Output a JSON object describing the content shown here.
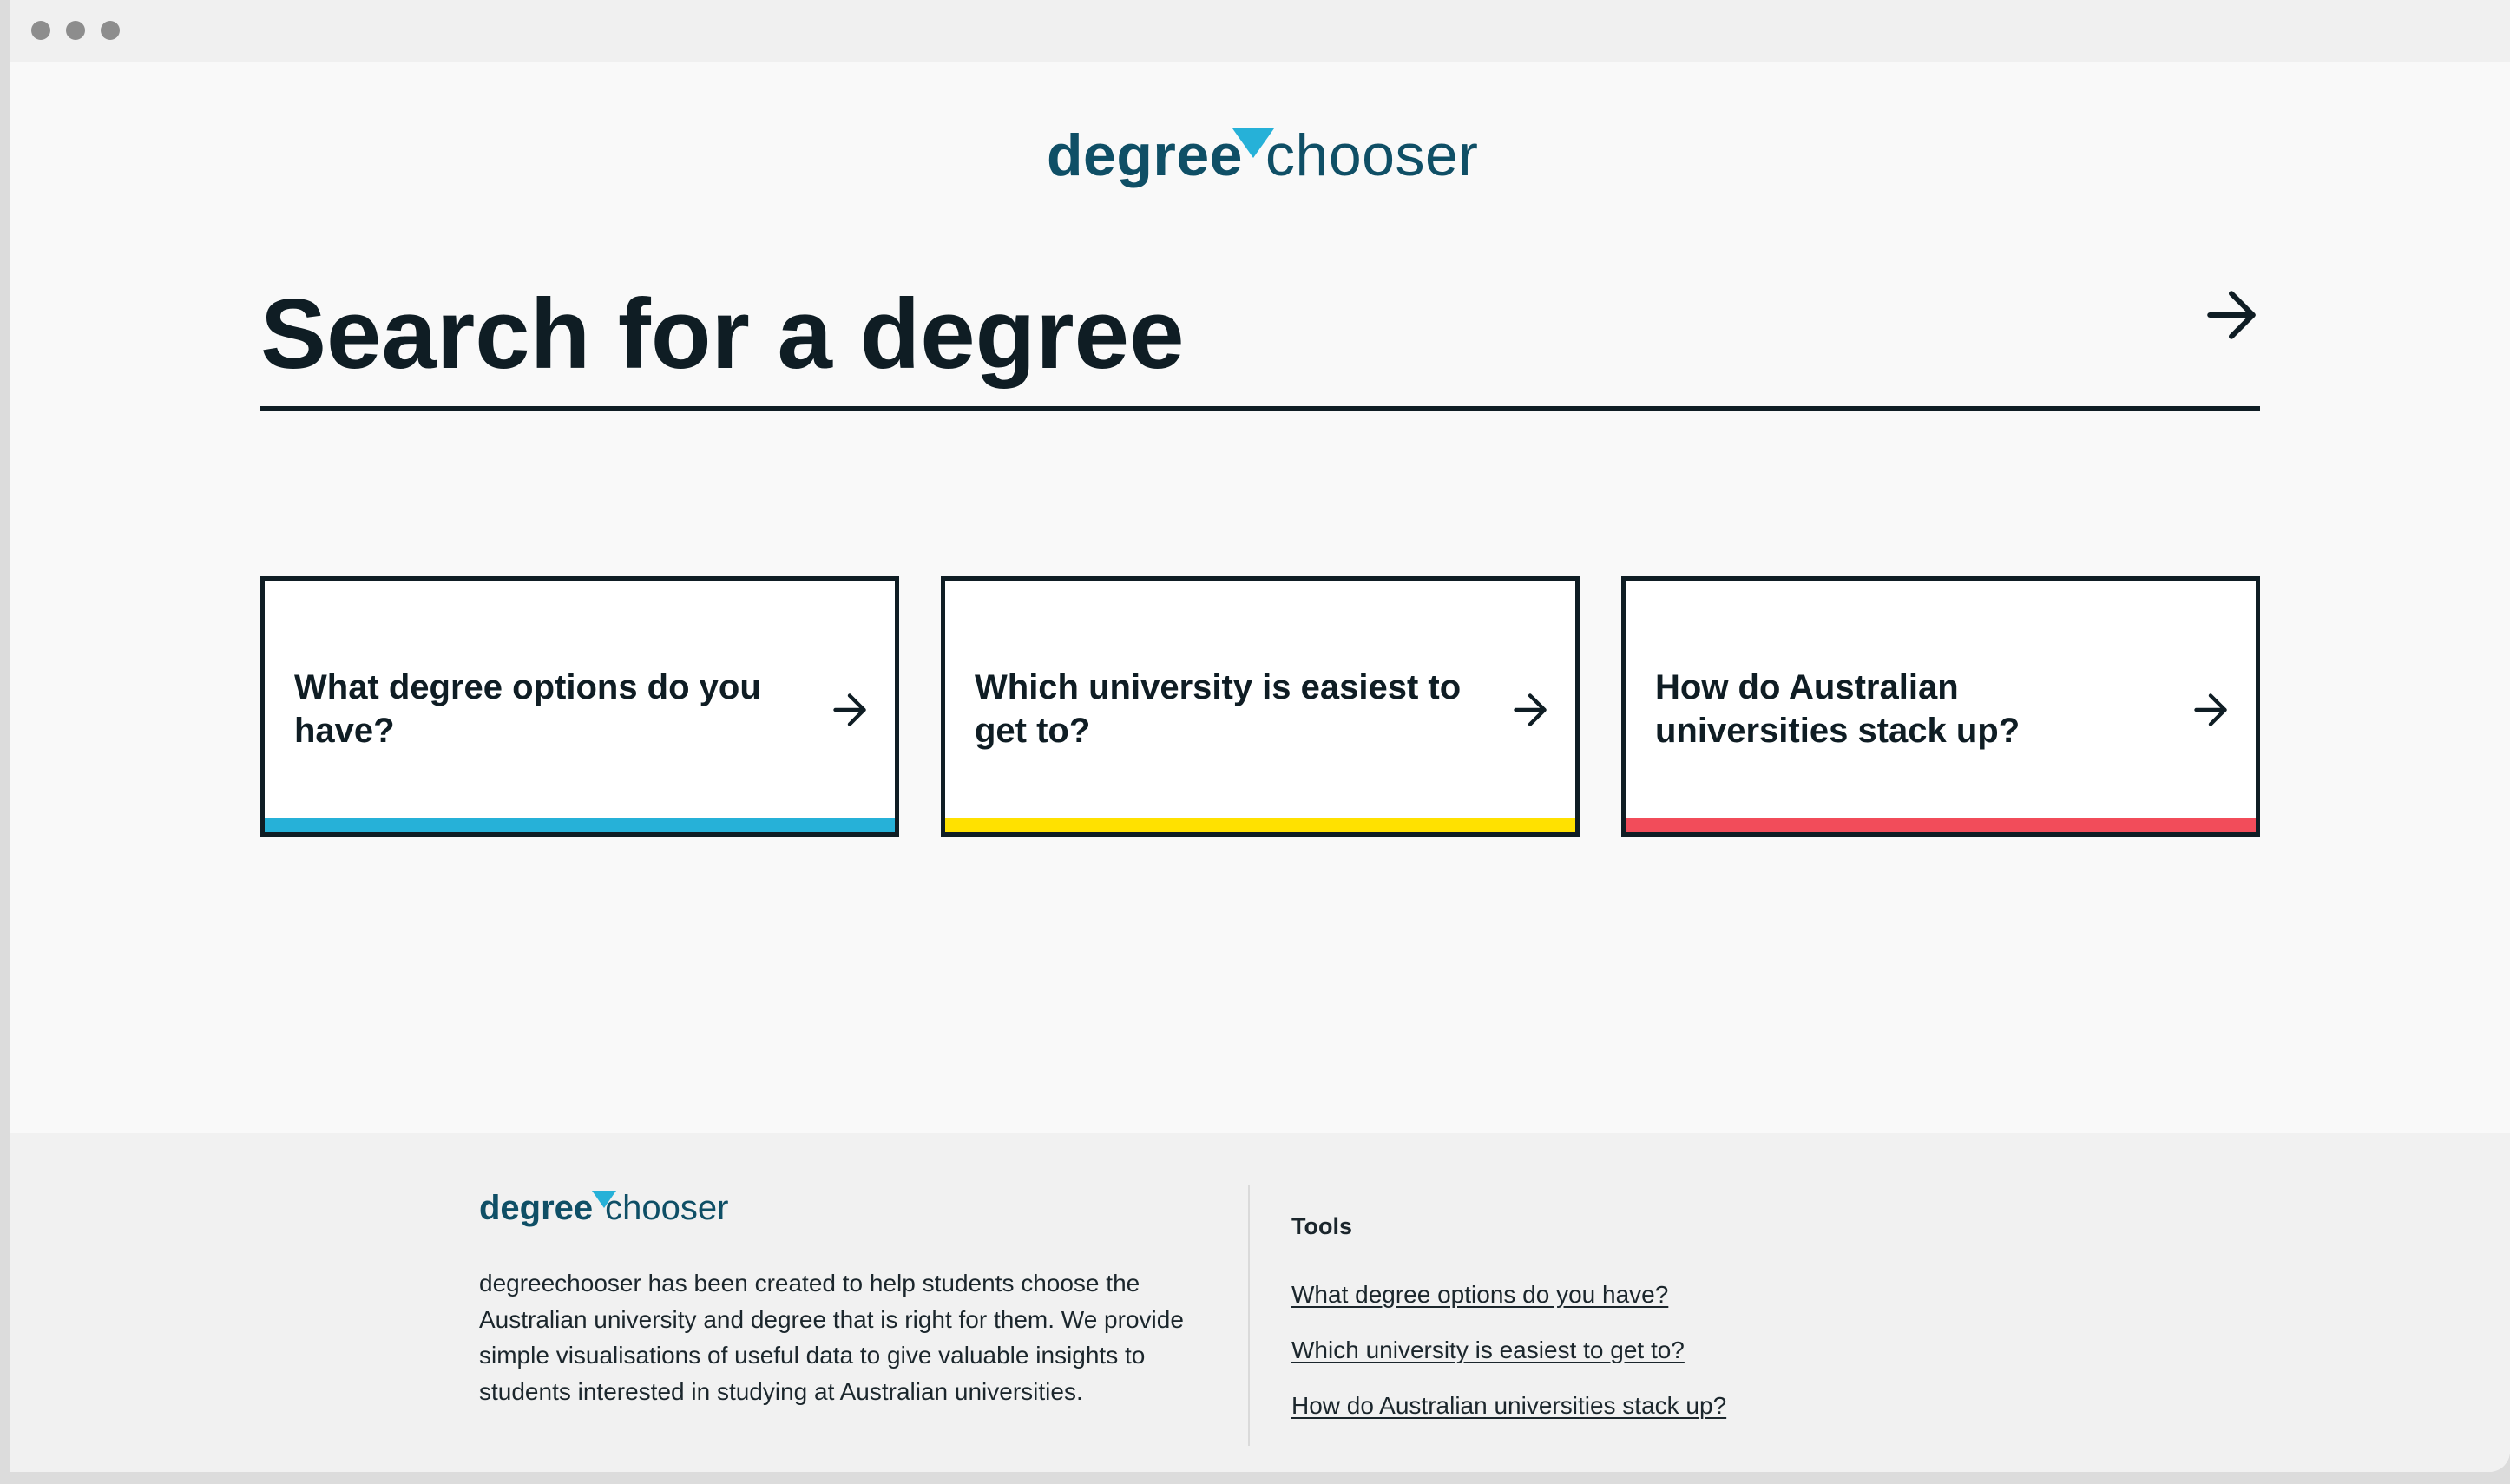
{
  "logo": {
    "bold": "degree",
    "light": "chooser",
    "colors": {
      "text": "#0f4f66",
      "triangle": "#26b1d8"
    }
  },
  "search": {
    "placeholder": "Search for a degree",
    "submit_icon": "arrow-right-icon"
  },
  "cards": [
    {
      "label": "What degree options do you have?",
      "accent": "#26b1d8",
      "icon": "arrow-right-icon"
    },
    {
      "label": "Which university is easiest to get to?",
      "accent": "#ffe100",
      "icon": "arrow-right-icon"
    },
    {
      "label": "How do Australian universities stack up?",
      "accent": "#f24c5a",
      "icon": "arrow-right-icon"
    }
  ],
  "footer": {
    "logo": {
      "bold": "degree",
      "light": "chooser"
    },
    "description": "degreechooser has been created to help students choose the Australian university and degree that is right for them. We provide simple visualisations of useful data to give valuable insights to students interested in studying at Australian universities.",
    "tools": {
      "heading": "Tools",
      "links": [
        "What degree options do you have?",
        "Which university is easiest to get to?",
        "How do Australian universities stack up?"
      ]
    }
  }
}
